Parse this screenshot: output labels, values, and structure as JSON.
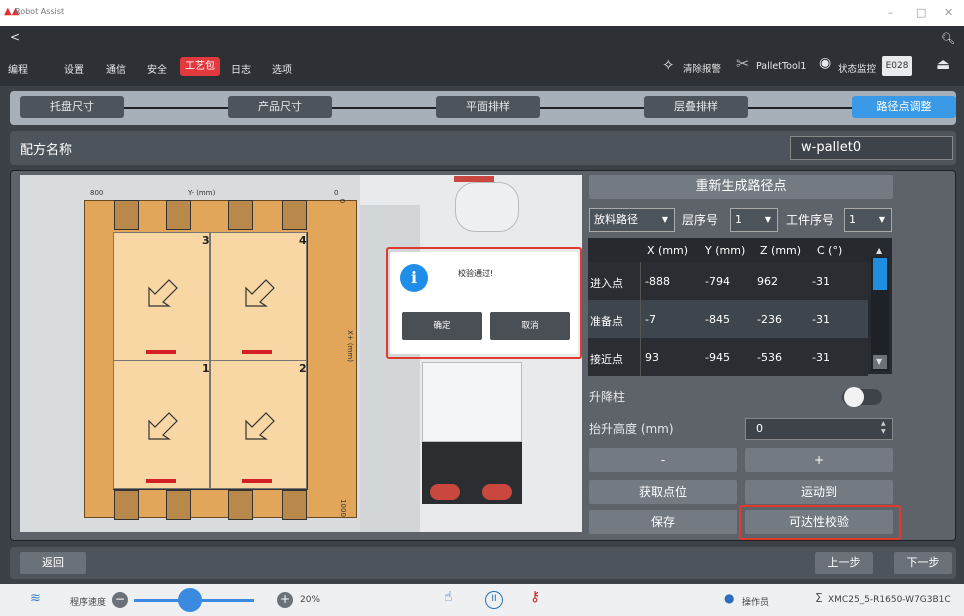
{
  "window": {
    "title": "Robot Assist",
    "controls": [
      "–",
      "□",
      "✕"
    ]
  },
  "menu": {
    "back": "<",
    "items": [
      "编程",
      "设置",
      "通信",
      "安全"
    ],
    "active": "工艺包",
    "items_after": [
      "日志",
      "选项"
    ],
    "search_icon": "search-icon"
  },
  "toolbar": {
    "clear_alarm": "清除报警",
    "tool": "PalletTool1",
    "status_monitor": "状态监控",
    "error_code": "E028"
  },
  "steps": [
    "托盘尺寸",
    "产品尺寸",
    "平面排样",
    "层叠排样",
    "路径点调整"
  ],
  "recipe": {
    "label": "配方名称",
    "value": "w-pallet0"
  },
  "pallet": {
    "y_axis_label": "Y- (mm)",
    "x_axis_label": "X+ (mm)",
    "y_left": "800",
    "y_right": "0",
    "x_top": "0",
    "x_bottom": "1000",
    "quadrant_numbers": [
      "3",
      "4",
      "1",
      "2"
    ]
  },
  "dialog": {
    "message": "校验通过!",
    "ok": "确定",
    "cancel": "取消",
    "icon": "i"
  },
  "path": {
    "regenerate": "重新生成路径点",
    "path_type": "放料路径",
    "layer_label": "层序号",
    "layer_value": "1",
    "workpiece_label": "工件序号",
    "workpiece_value": "1",
    "columns": [
      "X (mm)",
      "Y (mm)",
      "Z (mm)",
      "C (°)"
    ],
    "rows": [
      {
        "name": "进入点",
        "x": "-888",
        "y": "-794",
        "z": "962",
        "c": "-31"
      },
      {
        "name": "准备点",
        "x": "-7",
        "y": "-845",
        "z": "-236",
        "c": "-31"
      },
      {
        "name": "接近点",
        "x": "93",
        "y": "-945",
        "z": "-536",
        "c": "-31"
      }
    ],
    "lift_column": "升降柱",
    "lift_height_label": "抬升高度 (mm)",
    "lift_height_value": "0",
    "minus": "-",
    "plus": "+",
    "get_point": "获取点位",
    "move_to": "运动到",
    "save": "保存",
    "reachability_check": "可达性校验"
  },
  "nav": {
    "back": "返回",
    "prev": "上一步",
    "next": "下一步"
  },
  "status": {
    "speed_label": "程序速度",
    "speed_value": "20%",
    "speed_fraction": 0.2,
    "operator": "操作员",
    "device": "XMC25_5-R1650-W7G3B1C"
  }
}
